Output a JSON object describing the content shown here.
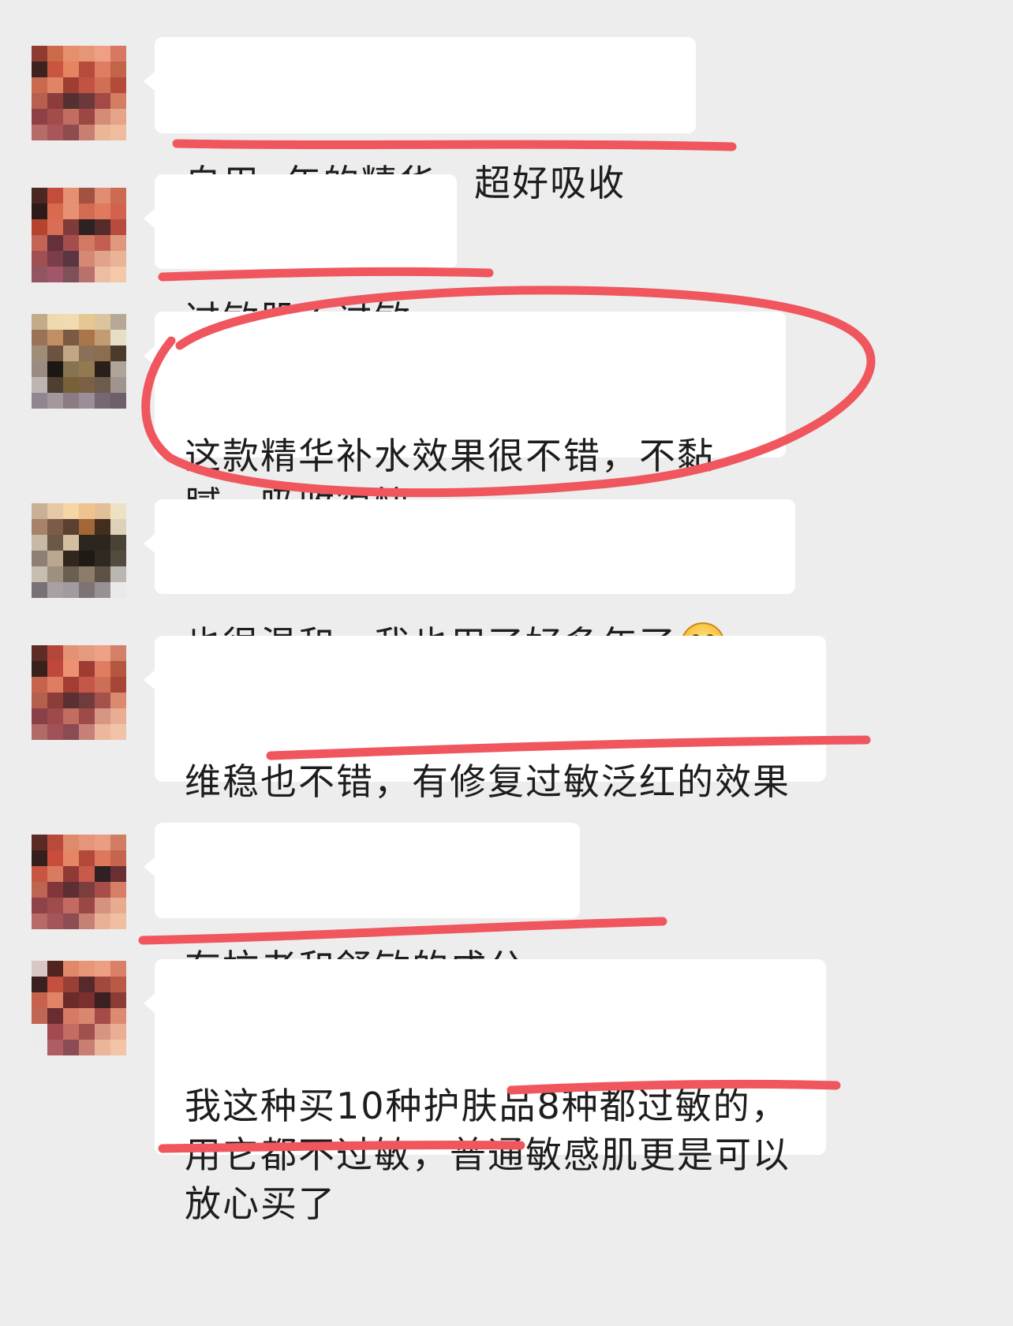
{
  "colors": {
    "background": "#ededed",
    "bubble": "#ffffff",
    "text": "#1d1d1d",
    "annotation": "#f0565e"
  },
  "messages": [
    {
      "text": "自用n年的精华，超好吸收",
      "emoji": "",
      "avatar_colors": [
        "#8e3b30",
        "#cd6a4a",
        "#e58f6f",
        "#e69677",
        "#ef9f84",
        "#d77962",
        "#3d2320",
        "#c9543f",
        "#e48560",
        "#b64a3c",
        "#e07c61",
        "#c16448",
        "#c9694e",
        "#e18365",
        "#9d3e32",
        "#c25244",
        "#cf6f55",
        "#b44b3a",
        "#b8604e",
        "#8c3d3b",
        "#553031",
        "#6c393a",
        "#a44945",
        "#d47d63",
        "#8f4047",
        "#a34c4c",
        "#c26d5f",
        "#9b4744",
        "#d48c77",
        "#e5a489",
        "#b56b68",
        "#a9555a",
        "#8f4c4f",
        "#c87f70",
        "#ebb597",
        "#f0bc9e"
      ]
    },
    {
      "text": "过敏肌不过敏",
      "emoji": "",
      "avatar_colors": [
        "#4a2723",
        "#c44c3a",
        "#e59070",
        "#a35140",
        "#e08e72",
        "#cc6a52",
        "#2d1b1a",
        "#d86b4f",
        "#e79172",
        "#d36a52",
        "#e0795e",
        "#d2624d",
        "#b5432e",
        "#d96d55",
        "#7e3b3a",
        "#2e2123",
        "#552b2c",
        "#b74b3f",
        "#c46455",
        "#64303a",
        "#a54d4c",
        "#d17961",
        "#c45e52",
        "#e0987c",
        "#a04f53",
        "#7a3d49",
        "#5a3642",
        "#d68874",
        "#dfa48b",
        "#e9b396",
        "#925662",
        "#a2566a",
        "#7f4f5a",
        "#b9716b",
        "#ecbda1",
        "#f4c9aa"
      ]
    },
    {
      "text": "这款精华补水效果很不错，不黏腻，吸收很快",
      "emoji": "",
      "avatar_colors": [
        "#c4a98a",
        "#eddab1",
        "#f1dcb2",
        "#e6c691",
        "#dcc49c",
        "#b6a894",
        "#9a7357",
        "#c18f63",
        "#7a5a42",
        "#a9764b",
        "#c39b72",
        "#e8ddc5",
        "#a08d78",
        "#6c5240",
        "#c2a685",
        "#8a7056",
        "#8c6d4f",
        "#4c3b2d",
        "#9a8b81",
        "#1d1714",
        "#867353",
        "#92794f",
        "#2a2019",
        "#aea49a",
        "#beb5b3",
        "#4e3f32",
        "#786137",
        "#7a6045",
        "#6d5c4b",
        "#9e9590",
        "#908690",
        "#a3989d",
        "#8b7c84",
        "#9c8e97",
        "#766872",
        "#6d5f68"
      ]
    },
    {
      "text": "也很温和，我也用了好多年了",
      "emoji": "grin",
      "avatar_colors": [
        "#c9b198",
        "#e6c9a4",
        "#f6d5a6",
        "#eec38f",
        "#e2bf96",
        "#eee0c4",
        "#a6826a",
        "#7b5c48",
        "#5a4031",
        "#a36637",
        "#422d1f",
        "#ddd1b9",
        "#c8b9a6",
        "#6b5846",
        "#d4bea0",
        "#2c2620",
        "#2d261f",
        "#4a4335",
        "#8d7f73",
        "#bba78f",
        "#31271f",
        "#1f1a16",
        "#302921",
        "#534b3d",
        "#c8bdb1",
        "#9e8f80",
        "#6b5f51",
        "#8e7c6a",
        "#5e5245",
        "#bab6b2",
        "#787075",
        "#a8a0a3",
        "#a19aa0",
        "#7d7274",
        "#989193",
        "#e9e9e9"
      ]
    },
    {
      "text": "维稳也不错，有修复过敏泛红的效果",
      "emoji": "",
      "avatar_colors": [
        "#5e2b26",
        "#b5473a",
        "#e49274",
        "#e79b7e",
        "#eda185",
        "#d28067",
        "#38201d",
        "#c0473b",
        "#ed9173",
        "#9e3c34",
        "#e07d61",
        "#b4573f",
        "#c6644b",
        "#dc7d61",
        "#a13d33",
        "#c5574a",
        "#cd6e57",
        "#a54638",
        "#b5604f",
        "#8c3c39",
        "#5a3032",
        "#6f3b3c",
        "#a4514b",
        "#dc8a6f",
        "#8b3f46",
        "#9e494b",
        "#c36d61",
        "#9c4b48",
        "#d79684",
        "#e8ad92",
        "#b06a67",
        "#a05157",
        "#8a4c52",
        "#c78075",
        "#ecb79d",
        "#f1c3a6"
      ]
    },
    {
      "text": "有抗老和舒敏的成分",
      "emoji": "",
      "avatar_colors": [
        "#5a2a24",
        "#b84a3b",
        "#df8a6b",
        "#e4957a",
        "#e99e82",
        "#d27c63",
        "#351f1d",
        "#c84d3b",
        "#e48666",
        "#b3493a",
        "#dd785d",
        "#c5654d",
        "#c65640",
        "#da7a5f",
        "#8f3a35",
        "#c8594b",
        "#2f2123",
        "#6b2f33",
        "#bd6551",
        "#82363a",
        "#5d2f33",
        "#7b3e3e",
        "#a84e49",
        "#d77f66",
        "#8f4248",
        "#a04c4d",
        "#c36b60",
        "#9a4745",
        "#d59281",
        "#e7ab8f",
        "#b66b67",
        "#a3555a",
        "#8e4d52",
        "#c68074",
        "#e8b193",
        "#f0bfa1"
      ]
    },
    {
      "text": "我这种买10种护肤品8种都过敏的，用它都不过敏，普通敏感肌更是可以放心买了",
      "emoji": "",
      "avatar_colors": [
        "#d9c7c5",
        "#52231f",
        "#e2886a",
        "#e79678",
        "#ed9f84",
        "#d98066",
        "#3a201e",
        "#c4503f",
        "#9a3f36",
        "#562a2b",
        "#a2493f",
        "#b95a47",
        "#c6614c",
        "#e08467",
        "#6c2a28",
        "#7b302d",
        "#3a2021",
        "#8b3c36",
        "#bf6654",
        "#6a2d2f",
        "#d77a64",
        "#d98870",
        "#a74b48",
        "#dc8b71",
        "#ececec",
        "#a24a4f",
        "#c36c61",
        "#a0504f",
        "#d89483",
        "#e9ae93",
        "#ececec",
        "#ae5d65",
        "#8b4d55",
        "#c87e73",
        "#ebb59a",
        "#f3c4a7"
      ]
    }
  ]
}
